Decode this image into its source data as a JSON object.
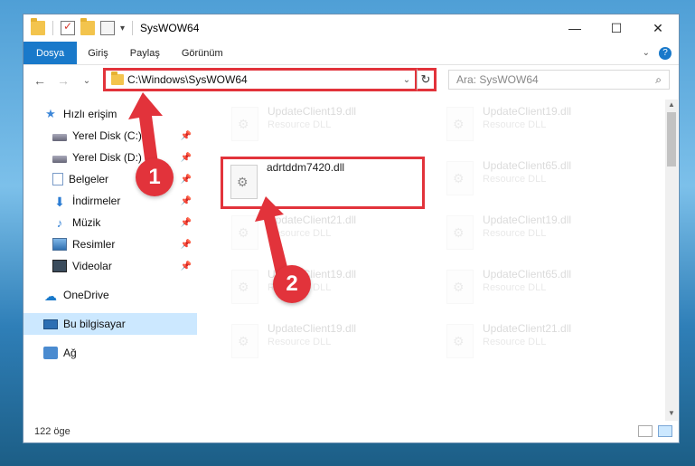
{
  "window": {
    "title": "SysWOW64"
  },
  "window_buttons": {
    "minimize": "—",
    "maximize": "☐",
    "close": "✕"
  },
  "ribbon": {
    "tabs": [
      "Dosya",
      "Giriş",
      "Paylaş",
      "Görünüm"
    ]
  },
  "nav": {
    "back": "←",
    "forward": "→",
    "recent": "⌄",
    "up": "↑"
  },
  "address": {
    "path": "C:\\Windows\\SysWOW64"
  },
  "search": {
    "placeholder": "Ara: SysWOW64"
  },
  "sidebar": {
    "items": [
      {
        "label": "Hızlı erişim",
        "icon": "star-icon"
      },
      {
        "label": "Yerel Disk (C:)",
        "icon": "disk-icon",
        "pinned": true
      },
      {
        "label": "Yerel Disk (D:)",
        "icon": "disk-icon",
        "pinned": true
      },
      {
        "label": "Belgeler",
        "icon": "document-icon",
        "pinned": true
      },
      {
        "label": "İndirmeler",
        "icon": "download-icon",
        "pinned": true
      },
      {
        "label": "Müzik",
        "icon": "music-icon",
        "pinned": true
      },
      {
        "label": "Resimler",
        "icon": "pictures-icon",
        "pinned": true
      },
      {
        "label": "Videolar",
        "icon": "videos-icon",
        "pinned": true
      },
      {
        "label": "OneDrive",
        "icon": "cloud-icon"
      },
      {
        "label": "Bu bilgisayar",
        "icon": "computer-icon",
        "selected": true
      },
      {
        "label": "Ağ",
        "icon": "network-icon"
      }
    ]
  },
  "files": [
    {
      "name": "UpdateClient19.dll",
      "type": "Resource DLL"
    },
    {
      "name": "UpdateClient19.dll",
      "type": "Resource DLL"
    },
    {
      "name": "adrtddm7420.dll",
      "type": "",
      "highlighted": true
    },
    {
      "name": "UpdateClient65.dll",
      "type": "Resource DLL"
    },
    {
      "name": "UpdateClient21.dll",
      "type": "Resource DLL"
    },
    {
      "name": "UpdateClient19.dll",
      "type": "Resource DLL"
    },
    {
      "name": "UpdateClient19.dll",
      "type": "Resource DLL"
    },
    {
      "name": "UpdateClient65.dll",
      "type": "Resource DLL"
    },
    {
      "name": "UpdateClient19.dll",
      "type": "Resource DLL"
    },
    {
      "name": "UpdateClient21.dll",
      "type": "Resource DLL"
    }
  ],
  "status": {
    "count": "122 öge"
  },
  "annotations": {
    "badge1": "1",
    "badge2": "2",
    "accent": "#e2333b"
  }
}
